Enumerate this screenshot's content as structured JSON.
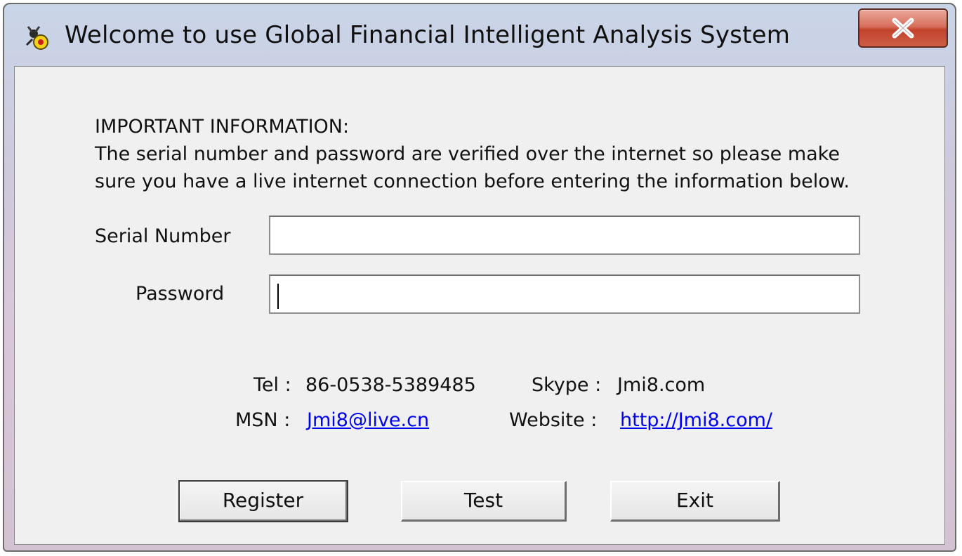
{
  "window": {
    "title": "Welcome to use Global Financial Intelligent Analysis System",
    "close_icon": "close-x-icon",
    "app_icon": "app-logo-icon"
  },
  "info": {
    "heading": "IMPORTANT INFORMATION:",
    "line1": "The serial number and password are verified over the internet so please make",
    "line2": "sure you have a live internet connection before entering the information below."
  },
  "form": {
    "serial_label": "Serial Number",
    "serial_value": "",
    "password_label": "Password",
    "password_value": ""
  },
  "contact": {
    "tel_label": "Tel :",
    "tel_value": "86-0538-5389485",
    "skype_label": "Skype :",
    "skype_value": "Jmi8.com",
    "msn_label": "MSN :",
    "msn_value": "Jmi8@live.cn",
    "website_label": "Website :",
    "website_value": "http://Jmi8.com/"
  },
  "buttons": {
    "register": "Register",
    "test": "Test",
    "exit": "Exit"
  },
  "colors": {
    "link": "#0000ee",
    "close_button": "#c2432c",
    "client_bg": "#f0f0f0"
  }
}
